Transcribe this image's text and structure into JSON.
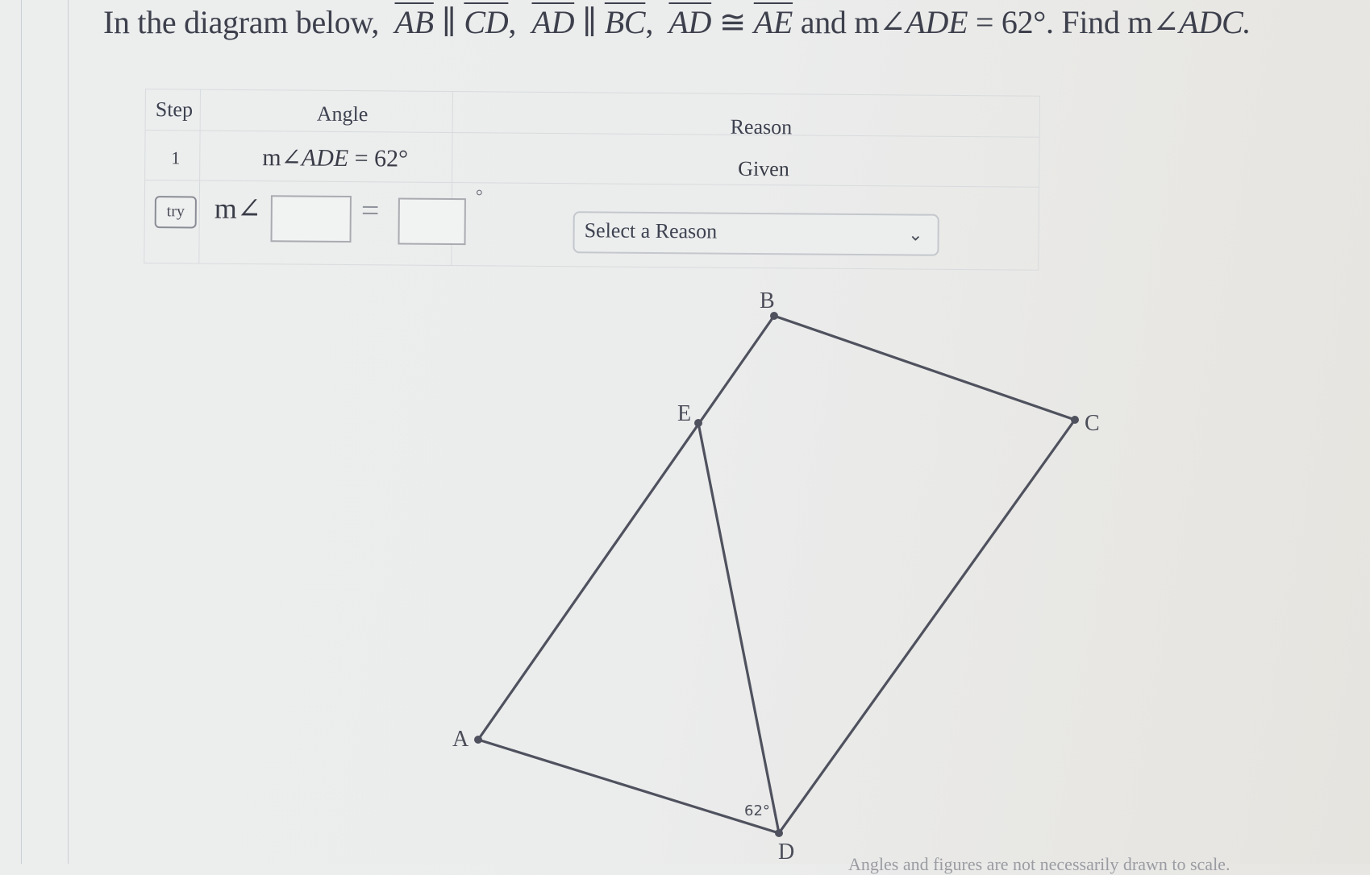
{
  "question": {
    "intro": "In the diagram below,",
    "segments": {
      "ab": "AB",
      "cd": "CD",
      "ad": "AD",
      "bc": "BC",
      "ad2": "AD",
      "ae": "AE"
    },
    "parallel_symbol": "∥",
    "congruent_symbol": "≅",
    "comma": ",",
    "and_text": "and",
    "given_angle_prefix": "m∠",
    "given_angle_name": "ADE",
    "given_angle_value": "= 62°.",
    "find_text": "Find",
    "find_angle_prefix": "m∠",
    "find_angle_name": "ADC."
  },
  "table": {
    "headers": {
      "step": "Step",
      "angle": "Angle",
      "reason": "Reason"
    },
    "rows": [
      {
        "step": "1",
        "angle_prefix": "m∠",
        "angle_name": "ADE",
        "angle_rest": " = 62°",
        "reason": "Given"
      }
    ],
    "entry_row": {
      "try_label": "try",
      "angle_prefix": "m∠",
      "angle_input_value": "",
      "equals": "=",
      "value_input_value": "",
      "degree_symbol": "°",
      "reason_select": {
        "selected": "Select a Reason",
        "icon": "chevron-down-icon"
      }
    }
  },
  "diagram": {
    "points": {
      "A": {
        "label": "A"
      },
      "B": {
        "label": "B"
      },
      "C": {
        "label": "C"
      },
      "D": {
        "label": "D"
      },
      "E": {
        "label": "E"
      }
    },
    "angle_marker": "62°"
  },
  "footnote": "Angles and figures are not necessarily drawn to scale."
}
